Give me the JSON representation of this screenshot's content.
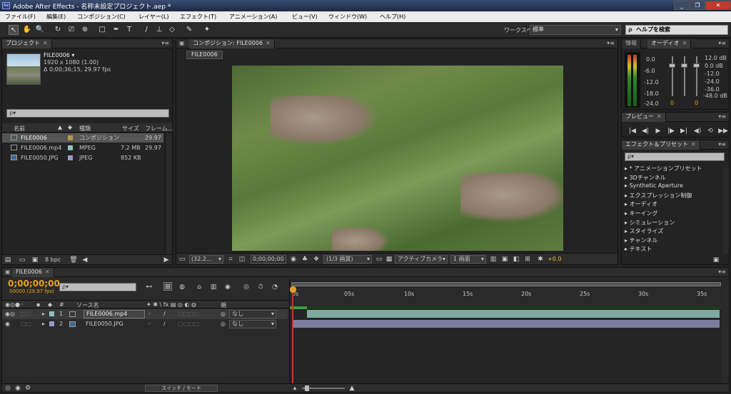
{
  "window": {
    "app_icon": "Ae",
    "title": "Adobe After Effects - 名称未設定プロジェクト.aep *",
    "buttons": [
      "minimize-icon",
      "maximize-icon",
      "close-icon"
    ],
    "min_label": "_",
    "max_label": "❐",
    "close_label": "✕"
  },
  "menu": [
    "ファイル(F)",
    "編集(E)",
    "コンポジション(C)",
    "レイヤー(L)",
    "エフェクト(T)",
    "アニメーション(A)",
    "ビュー(V)",
    "ウィンドウ(W)",
    "ヘルプ(H)"
  ],
  "toolbar": {
    "tools": [
      "selection-tool-icon",
      "hand-tool-icon",
      "zoom-tool-icon",
      "rotate-tool-icon",
      "camera-tool-icon",
      "pan-behind-tool-icon",
      "rectangle-tool-icon",
      "pen-tool-icon",
      "type-tool-icon",
      "brush-tool-icon",
      "clone-stamp-tool-icon",
      "eraser-tool-icon",
      "roto-brush-tool-icon",
      "puppet-pin-tool-icon"
    ],
    "glyphs": [
      "↖",
      "✋",
      "🔍",
      "↻",
      "⎚",
      "⊕",
      "□",
      "✒",
      "T",
      "/",
      "⊥",
      "◇",
      "✎",
      "✦"
    ],
    "workspace_label": "ワークスペース：",
    "workspace_value": "標準",
    "help_placeholder": "ヘルプを検索"
  },
  "project": {
    "tab": "プロジェクト",
    "selected_name": "FILE0006 ▾",
    "selected_size": "1920 x 1080 (1.00)",
    "selected_duration": "Δ 0;00;36;15, 29.97 fps",
    "search_placeholder": "ρ▾",
    "columns": [
      "名前",
      "種類",
      "サイズ",
      "フレーム..."
    ],
    "items": [
      {
        "name": "FILE0006",
        "type": "コンポジション",
        "size": "",
        "fps": "29.97",
        "label": "#b8964a"
      },
      {
        "name": "FILE0006.mp4",
        "type": "MPEG",
        "size": "7.2 MB",
        "fps": "29.97",
        "label": "#8ec0c0"
      },
      {
        "name": "FILE0050.JPG",
        "type": "JPEG",
        "size": "852 KB",
        "fps": "",
        "label": "#9a98c8"
      }
    ],
    "bpc": "8 bpc"
  },
  "composition": {
    "tab": "コンポジション: FILE0006",
    "subtab": "FILE0006",
    "zoom": "(32.2...",
    "timecode": "0;00;00;00",
    "resolution": "(1/3 画質)",
    "camera": "アクティブカメラ",
    "views": "1 画面",
    "exposure": "+0.0"
  },
  "info_audio": {
    "tab_info": "情報",
    "tab_audio": "オーディオ",
    "left_scale": [
      "0.0",
      "-6.0",
      "-12.0",
      "-18.0",
      "-24.0"
    ],
    "right_scale": [
      "12.0 dB",
      "0.0 dB",
      "-12.0",
      "-24.0",
      "-36.0",
      "-48.0 dB"
    ],
    "level_l": "0",
    "level_r": "0"
  },
  "preview": {
    "tab": "プレビュー",
    "controls": [
      "first-frame-icon",
      "prev-frame-icon",
      "play-icon",
      "next-frame-icon",
      "last-frame-icon",
      "audio-icon",
      "loop-icon",
      "ram-preview-icon"
    ],
    "glyphs": [
      "|◀",
      "◀|",
      "▶",
      "|▶",
      "▶|",
      "◀)",
      "⟲",
      "▶▶"
    ]
  },
  "effects": {
    "tab": "エフェクト＆プリセット",
    "search_placeholder": "ρ▾",
    "items": [
      "* アニメーションプリセット",
      "3Dチャンネル",
      "Synthetic Aperture",
      "エクスプレッション制御",
      "オーディオ",
      "キーイング",
      "シミュレーション",
      "スタイライズ",
      "チャンネル",
      "テキスト"
    ]
  },
  "timeline": {
    "tab": "FILE0006",
    "timecode": "0;00;00;00",
    "frame_info": "00000 (29.97 fps)",
    "search_placeholder": "ρ▾",
    "col_num": "#",
    "col_source": "ソース名",
    "col_parent": "親",
    "ruler": [
      "0s",
      "05s",
      "10s",
      "15s",
      "20s",
      "25s",
      "30s",
      "35s"
    ],
    "layers": [
      {
        "num": "1",
        "name": "FILE0006.mp4",
        "parent": "なし",
        "label": "#8ec0c0",
        "bar": "#7fa8a0"
      },
      {
        "num": "2",
        "name": "FILE0050.JPG",
        "parent": "なし",
        "label": "#9a98c8",
        "bar": "#7c7ea0"
      }
    ],
    "switch_mode": "スイッチ / モード"
  }
}
